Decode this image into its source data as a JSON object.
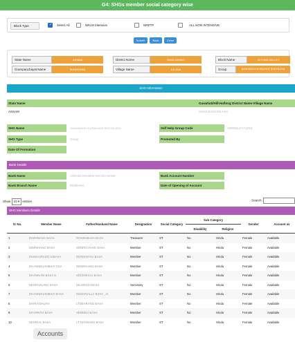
{
  "header": {
    "title": "G4: SHGs member social category wise"
  },
  "filters": {
    "block_type_label": "Block Type",
    "options": [
      {
        "label": "Select All",
        "checked": true
      },
      {
        "label": "NRLM Intensive",
        "checked": false
      },
      {
        "label": "NRETP",
        "checked": false
      },
      {
        "label": "ALL NON INTENSIVE",
        "checked": false
      }
    ]
  },
  "buttons": {
    "submit": "Submit",
    "back": "Back",
    "close": "Close"
  },
  "location": {
    "state_label": "State Name",
    "state_value": "ASSAM",
    "district_label": "District Name",
    "district_value": "DIMA HASAO",
    "block_label": "Block Name",
    "block_value": "DIYUNG VALLEY",
    "gp_label": "Grampanchayat Name",
    "gp_value": "SUNGJUNG",
    "village_label": "Village Name",
    "village_value": "DILASA",
    "group_label": "Group",
    "group_value": "GANGMATA KHURAKHOE SHG DILASA"
  },
  "shg_info": {
    "title": "SHG Information",
    "col_state": "State Name",
    "col_path": "Guwahati/Hill-Haflong District Name-Village Name",
    "row_state": "ASSAM",
    "row_path": "SUNGJUNG/DILASA",
    "shg_name_label": "SHG Name",
    "shg_name_value": "GANGMATA KHURAKHOE SHG DILASA",
    "shg_type_label": "SHG Type",
    "shg_type_value": "Group",
    "formation_label": "Date Of Formation",
    "formation_value": "",
    "selfhelp_label": "Self Help Group Code",
    "selfhelp_value": "190001LEYA1053",
    "promoted_label": "Promoted By",
    "promoted_value": ""
  },
  "bank": {
    "title": "Bank Details",
    "bank_name_label": "Bank Name",
    "bank_name_value": "ASSAM GRAMIN VIKASH BANK",
    "branch_label": "Bank Branch Name",
    "branch_value": "MAIBANG",
    "account_label": "Bank Account Number",
    "account_value": "",
    "opening_label": "Date of Opening of Account",
    "opening_value": ""
  },
  "table_controls": {
    "show": "Show",
    "entries_value": "10",
    "entries": "entries",
    "search": "Search:"
  },
  "members": {
    "title": "SHG Members Details",
    "headers": {
      "srno": "Sr No.",
      "member": "Member Name",
      "father": "Father/Husband Name",
      "designation": "Designation",
      "social": "Social Category",
      "sub": "Sub Category",
      "disability": "Disability",
      "religion": "Religion",
      "gender": "Gender",
      "account": "Account av"
    },
    "rows": [
      [
        "1",
        "DHIRINANG BASA",
        "RONSHBASA BASA",
        "Treasurer",
        "ST",
        "No",
        "Hindu",
        "Female",
        "Available"
      ],
      [
        "2",
        "DIMRIHANG BASA",
        "SONRICHANG BASA",
        "Member",
        "ST",
        "No",
        "Hindu",
        "Female",
        "Available"
      ],
      [
        "3",
        "DHIMAURANG NIBASA",
        "DERINSHAU BASA",
        "Member",
        "ST",
        "No",
        "Hindu",
        "Female",
        "Available"
      ],
      [
        "4",
        "DHANNEHAMBAYI GSA",
        "DENIRHANG BASA",
        "Member",
        "ST",
        "No",
        "Hindu",
        "Female",
        "Available"
      ],
      [
        "5",
        "DHANNANI BASA G",
        "SOUNSHAU BASA",
        "Member",
        "ST",
        "No",
        "Hindu",
        "Female",
        "Available"
      ],
      [
        "6",
        "DEHRAINANG BASA",
        "DILONGDI BASA",
        "Secretary",
        "ST",
        "No",
        "Hindu",
        "Female",
        "Available"
      ],
      [
        "7",
        "DHANNEHAMBAYI BASA",
        "DEDISNALLY BASA  _AI",
        "Member",
        "ST",
        "No",
        "Hindu",
        "Female",
        "Available"
      ],
      [
        "8",
        "DHIRAIDAUAH",
        "LTDEHRANG BASA",
        "Member",
        "ST",
        "No",
        "Hindu",
        "Female",
        "Available"
      ],
      [
        "9",
        "DHANNAH BASA",
        "SEMBEH BASA",
        "Member",
        "ST",
        "No",
        "Hindu",
        "Female",
        "Available"
      ],
      [
        "10",
        "DEHRIAL BASA",
        "LT DHANANG BASA",
        "Member",
        "ST",
        "No",
        "Hindu",
        "Female",
        "Available"
      ]
    ]
  },
  "overlay": {
    "text": "Accounts"
  }
}
